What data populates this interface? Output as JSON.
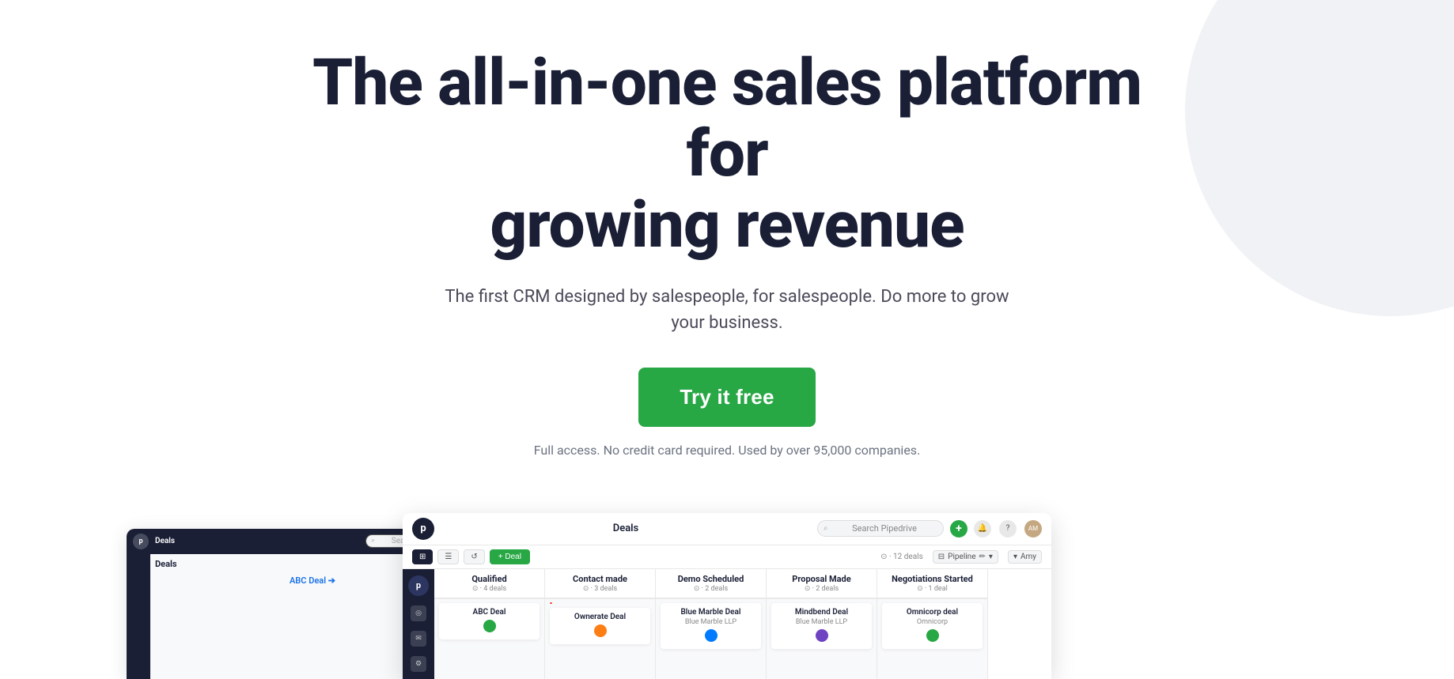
{
  "hero": {
    "title_line1": "The all-in-one sales platform for",
    "title_line2": "growing revenue",
    "subtitle": "The first CRM designed by salespeople, for salespeople. Do more to grow your business.",
    "cta_label": "Try it free",
    "cta_note": "Full access. No credit card required. Used by over 95,000 companies.",
    "bg_circle_color": "#f0f2f5"
  },
  "crm_app": {
    "logo_text": "p",
    "title": "Deals",
    "search_placeholder": "Search Pipedrive",
    "add_button_label": "+",
    "stats_text": "⊙ · 12 deals",
    "pipeline_label": "Pipeline",
    "user_label": "Amy",
    "toolbar_buttons": [
      "filter",
      "list",
      "refresh",
      "Deal"
    ],
    "columns": [
      {
        "title": "Qualified",
        "count": "⊙ · 4 deals",
        "cards": [
          {
            "title": "ABC Deal",
            "company": "",
            "avatar_color": "green"
          }
        ]
      },
      {
        "title": "Contact made",
        "count": "⊙ · 3 deals",
        "cards": [
          {
            "title": "Ownerate Deal",
            "company": "",
            "avatar_color": "orange"
          }
        ]
      },
      {
        "title": "Demo Scheduled",
        "count": "⊙ · 2 deals",
        "cards": [
          {
            "title": "Blue Marble Deal",
            "company": "Blue Marble LLP",
            "avatar_color": "blue"
          }
        ]
      },
      {
        "title": "Proposal Made",
        "count": "⊙ · 2 deals",
        "cards": [
          {
            "title": "Mindbend Deal",
            "company": "Blue Marble LLP",
            "avatar_color": "purple"
          }
        ]
      },
      {
        "title": "Negotiations Started",
        "count": "⊙ · 1 deal",
        "cards": [
          {
            "title": "Omnicorp deal",
            "company": "Omnicorp",
            "avatar_color": "green"
          }
        ]
      }
    ]
  },
  "crm_app_back": {
    "logo_text": "p",
    "title": "Deals",
    "search_placeholder": "Search Pipedrive",
    "deal_item": "ABC Deal ➔"
  },
  "icons": {
    "search": "🔍",
    "bell": "🔔",
    "question": "?",
    "user": "👤",
    "filter": "⊞",
    "list": "☰",
    "refresh": "↺",
    "location": "◎",
    "message": "✉",
    "settings": "⚙"
  }
}
